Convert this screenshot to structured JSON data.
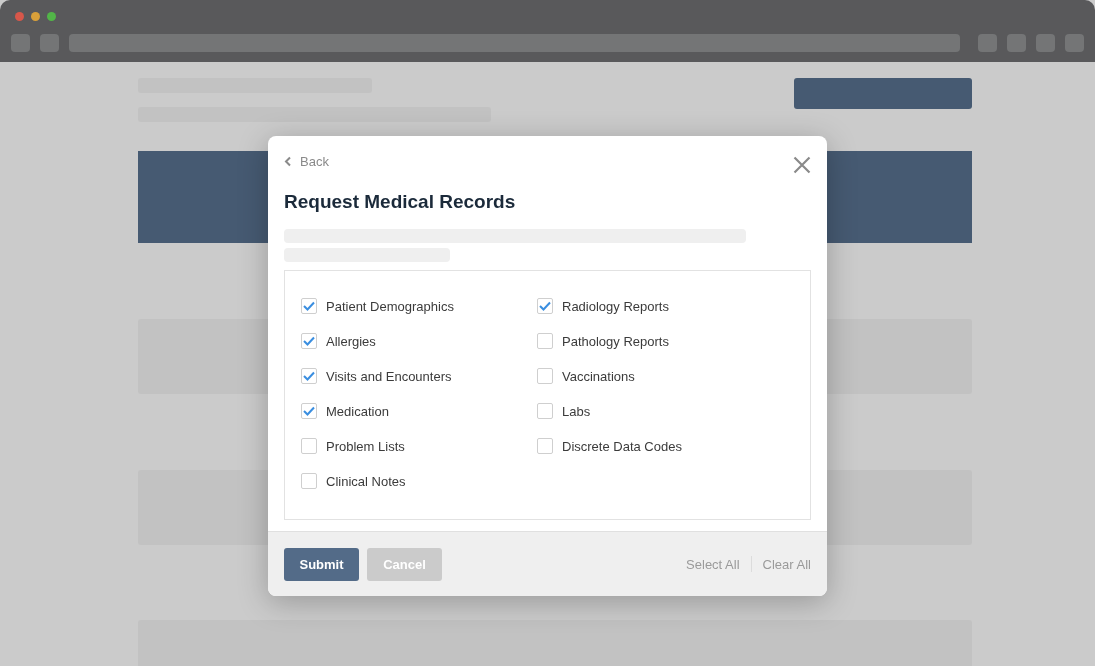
{
  "modal": {
    "back_label": "Back",
    "title": "Request Medical Records",
    "checklist": {
      "columns": [
        {
          "items": [
            {
              "label": "Patient Demographics",
              "checked": true
            },
            {
              "label": "Allergies",
              "checked": true
            },
            {
              "label": "Visits and Encounters",
              "checked": true
            },
            {
              "label": "Medication",
              "checked": true
            },
            {
              "label": "Problem Lists",
              "checked": false
            },
            {
              "label": "Clinical Notes",
              "checked": false
            }
          ]
        },
        {
          "items": [
            {
              "label": "Radiology Reports",
              "checked": true
            },
            {
              "label": "Pathology Reports",
              "checked": false
            },
            {
              "label": "Vaccinations",
              "checked": false
            },
            {
              "label": "Labs",
              "checked": false
            },
            {
              "label": "Discrete Data Codes",
              "checked": false
            }
          ]
        }
      ]
    },
    "footer": {
      "buttons": [
        {
          "label": "Submit",
          "kind": "primary"
        },
        {
          "label": "Cancel",
          "kind": "secondary"
        }
      ],
      "links": [
        "Select All",
        "Clear All"
      ]
    }
  }
}
